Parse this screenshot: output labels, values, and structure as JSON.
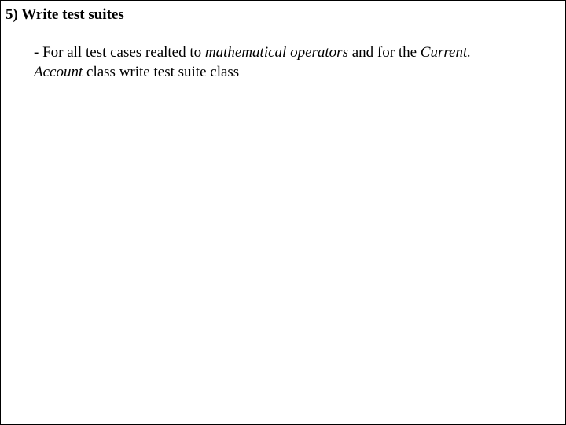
{
  "heading": "5) Write test suites",
  "paragraph": {
    "prefix": "- For all test cases realted to ",
    "emph1": "mathematical operators",
    "mid": " and for the ",
    "emph2": "Current. Account",
    "suffix": " class write test suite class"
  }
}
